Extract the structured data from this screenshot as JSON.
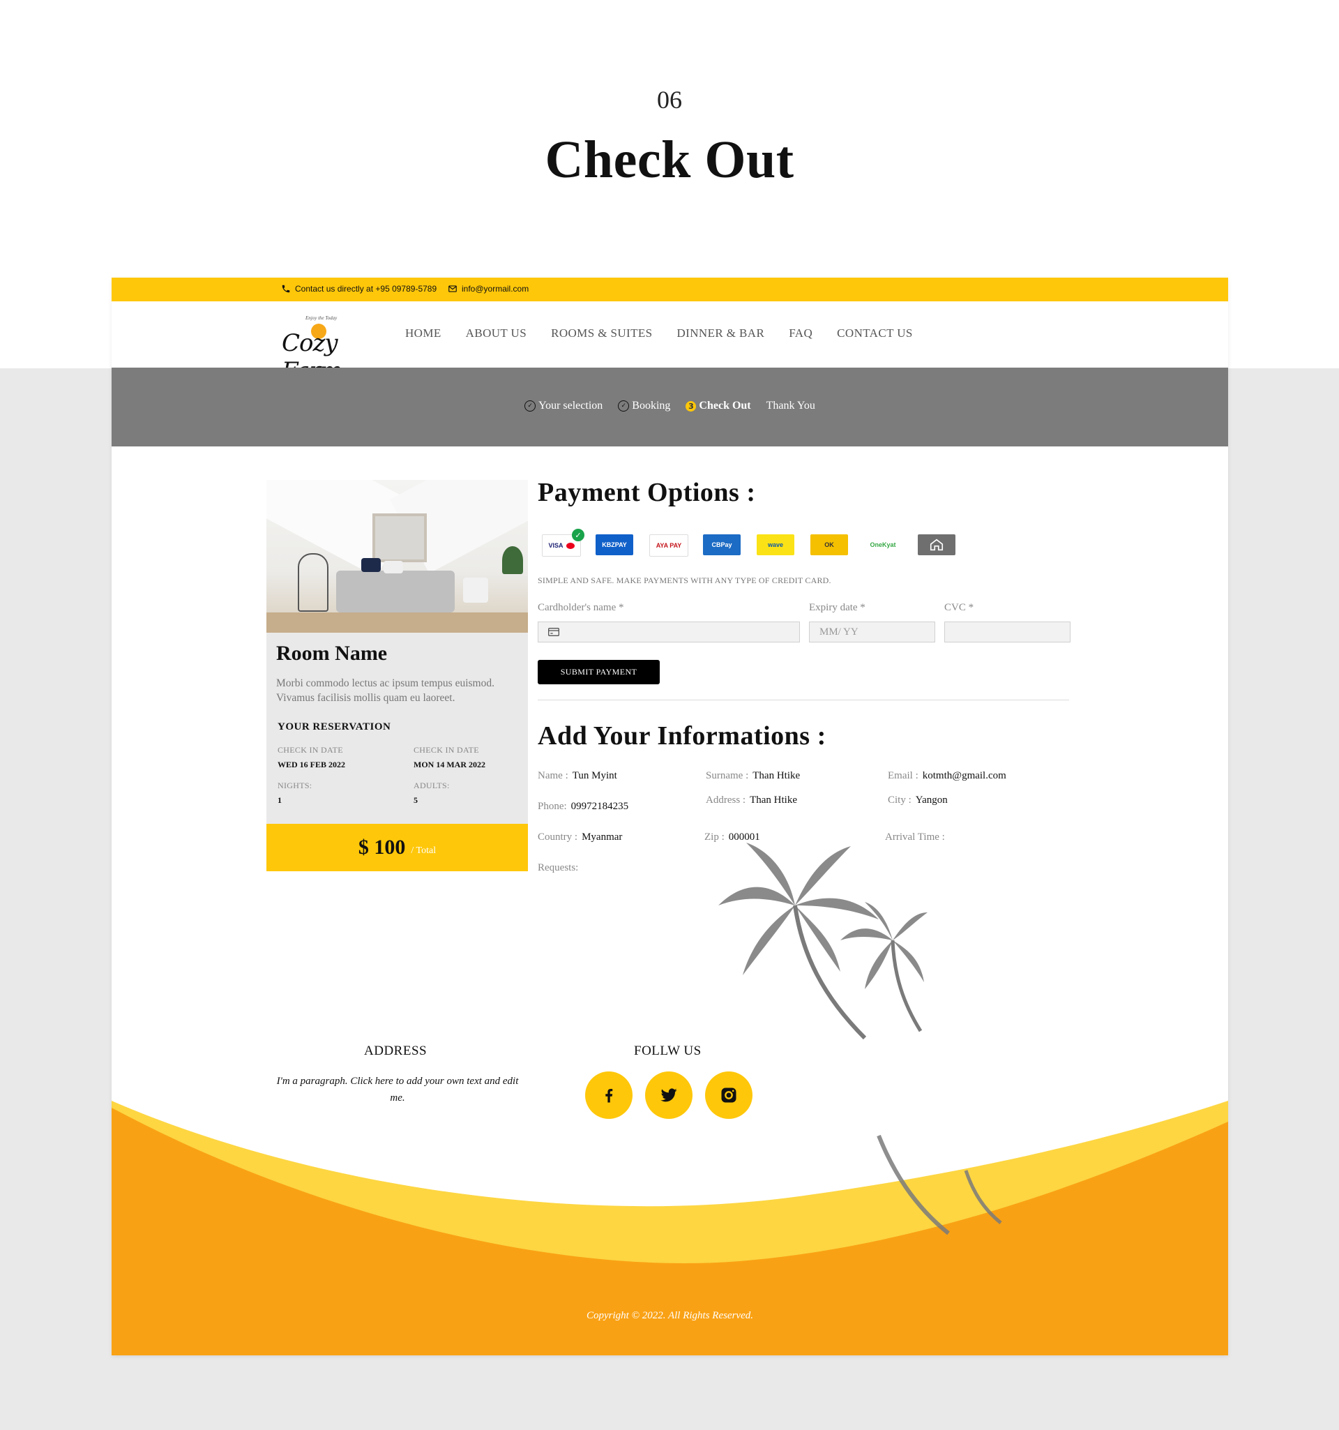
{
  "hero": {
    "number": "06",
    "title": "Check Out"
  },
  "topbar": {
    "phone": "Contact us directly at +95 09789-5789",
    "email": "info@yormail.com"
  },
  "brand": {
    "name": "Cozy Farm",
    "tagline": "Enjoy the Today"
  },
  "menu": [
    "HOME",
    "ABOUT US",
    "ROOMS & SUITES",
    "DINNER & BAR",
    "FAQ",
    "CONTACT US"
  ],
  "steps": [
    {
      "label": "Your selection",
      "state": "done"
    },
    {
      "label": "Booking",
      "state": "done"
    },
    {
      "label": "Check Out",
      "state": "active",
      "number": "3"
    },
    {
      "label": "Thank You",
      "state": "todo"
    }
  ],
  "room": {
    "name": "Room Name",
    "description": "Morbi commodo lectus ac ipsum tempus euismod. Vivamus facilisis mollis quam eu laoreet.",
    "reservation_title": "YOUR RESERVATION",
    "checkin_label": "CHECK IN DATE",
    "checkin_value": "WED 16 FEB 2022",
    "checkout_label": "CHECK IN DATE",
    "checkout_value": "MON 14 MAR 2022",
    "nights_label": "NIGHTS:",
    "nights_value": "1",
    "adults_label": "ADULTS:",
    "adults_value": "5",
    "price_amount": "$ 100",
    "price_suffix": "/ Total"
  },
  "payment": {
    "title": "Payment Options :",
    "methods": [
      "VISA",
      "KBZPAY",
      "AYA PAY",
      "CBPay",
      "wave",
      "OK",
      "OneKyat",
      "home"
    ],
    "note": "SIMPLE AND SAFE. MAKE PAYMENTS WITH ANY TYPE OF CREDIT CARD.",
    "cardholder_label": "Cardholder's name *",
    "expiry_label": "Expiry date *",
    "expiry_placeholder": "MM/ YY",
    "cvc_label": "CVC *",
    "submit": "SUBMIT PAYMENT"
  },
  "info": {
    "title": "Add Your Informations :",
    "name_label": "Name :",
    "name": "Tun Myint",
    "surname_label": "Surname :",
    "surname": "Than Htike",
    "email_label": "Email :",
    "email": "kotmth@gmail.com",
    "phone_label": "Phone:",
    "phone": "09972184235",
    "address_label": "Address :",
    "address": "Than Htike",
    "city_label": "City :",
    "city": "Yangon",
    "country_label": "Country :",
    "country": "Myanmar",
    "zip_label": "Zip :",
    "zip": "000001",
    "arrival_label": "Arrival Time :",
    "requests_label": "Requests:"
  },
  "footer": {
    "address_title": "ADDRESS",
    "address_text": "I'm a paragraph. Click here to add your own text and edit me.",
    "follow_title": "FOLLW US",
    "social": [
      "facebook-icon",
      "twitter-icon",
      "instagram-icon"
    ],
    "copyright": "Copyright © 2022. All Rights Reserved."
  },
  "colors": {
    "accent": "#fec70a",
    "orange": "#f9a114",
    "gray": "#7c7c7c"
  }
}
